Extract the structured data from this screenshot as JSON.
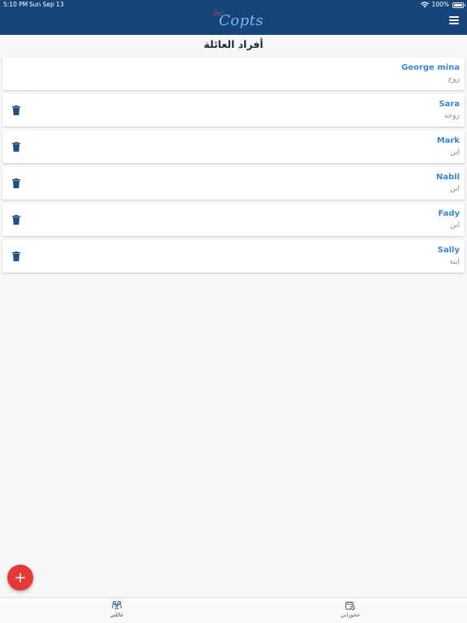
{
  "status_bar": {
    "time": "5:10 PM",
    "date": "Sun Sep 13",
    "battery": "100%"
  },
  "header": {
    "logo_small": "ttv",
    "logo_text": "Copts"
  },
  "page": {
    "title": "أفراد العائلة"
  },
  "members": [
    {
      "name": "George mina",
      "relation": "زوج",
      "deletable": false
    },
    {
      "name": "Sara",
      "relation": "زوجة",
      "deletable": true
    },
    {
      "name": "Mark",
      "relation": "ابن",
      "deletable": true
    },
    {
      "name": "Nabil",
      "relation": "ابن",
      "deletable": true
    },
    {
      "name": "Fady",
      "relation": "ابن",
      "deletable": true
    },
    {
      "name": "Sally",
      "relation": "ابنة",
      "deletable": true
    }
  ],
  "fab": {
    "label": "+"
  },
  "tabs": [
    {
      "label": "عائلتي",
      "icon": "family-icon",
      "active": true
    },
    {
      "label": "حجوزاتي",
      "icon": "calendar-icon",
      "active": false
    }
  ],
  "colors": {
    "header_bg": "#17457a",
    "name_blue": "#3a87d1",
    "fab_red": "#e53935",
    "trash_blue": "#1f4f86"
  }
}
